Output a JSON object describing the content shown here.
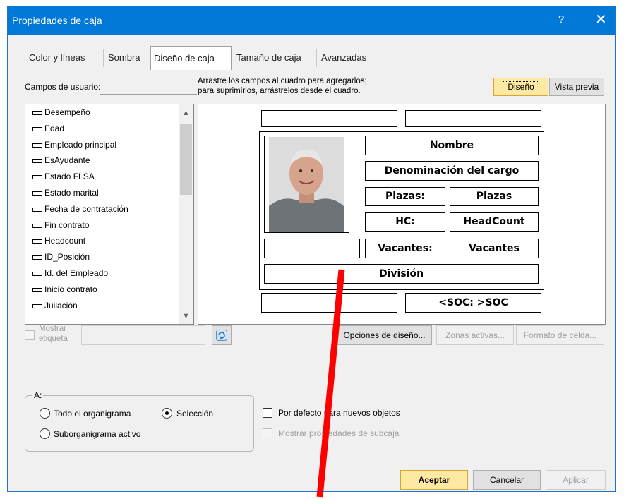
{
  "window": {
    "title": "Propiedades de caja",
    "help_glyph": "?",
    "close_glyph": "✕"
  },
  "tabs": [
    {
      "label": "Color y líneas"
    },
    {
      "label": "Sombra"
    },
    {
      "label": "Diseño de caja"
    },
    {
      "label": "Tamaño de caja"
    },
    {
      "label": "Avanzadas"
    }
  ],
  "user_fields": {
    "label": "Campos de usuario:",
    "items": [
      "Desempeño",
      "Edad",
      "Empleado principal",
      "EsAyudante",
      "Estado FLSA",
      "Estado marital",
      "Fecha de contratación",
      "Fin contrato",
      "Headcount",
      "ID_Posición",
      "Id. del Empleado",
      "Inicio contrato",
      "Juilación"
    ],
    "scroll_up": "▲",
    "scroll_down": "▼"
  },
  "instructions": {
    "line1": "Arrastre los campos al cuadro para agregarlos;",
    "line2": "para suprimirlos, arrástrelos desde el cuadro."
  },
  "view_buttons": {
    "design": "Diseño",
    "preview": "Vista previa"
  },
  "box_layout": {
    "name": "Nombre",
    "title": "Denominación del cargo",
    "plazas_label": "Plazas:",
    "plazas_value": "Plazas",
    "hc_label": "HC:",
    "hc_value": "HeadCount",
    "vacantes_label": "Vacantes:",
    "vacantes_value": "Vacantes",
    "division": "División",
    "soc": "<SOC: >SOC"
  },
  "show_label": {
    "line1": "Mostrar",
    "line2": "etiqueta"
  },
  "action_buttons": {
    "design_options": "Opciones de diseño...",
    "hot_zones": "Zonas activas...",
    "cell_format": "Formato de celda..."
  },
  "apply_to": {
    "legend": "A:",
    "whole_chart": "Todo el organigrama",
    "selection": "Selección",
    "active_subchart": "Suborganigrama activo",
    "selected": "selection"
  },
  "options": {
    "default_new": "Por defecto para nuevos objetos",
    "show_subbox": "Mostrar propiedades de subcaja"
  },
  "footer": {
    "ok": "Aceptar",
    "cancel": "Cancelar",
    "apply": "Aplicar"
  },
  "colors": {
    "title_bar": "#0078d7",
    "ok_button": "#fde9a1",
    "annotation": "#ff0000"
  }
}
